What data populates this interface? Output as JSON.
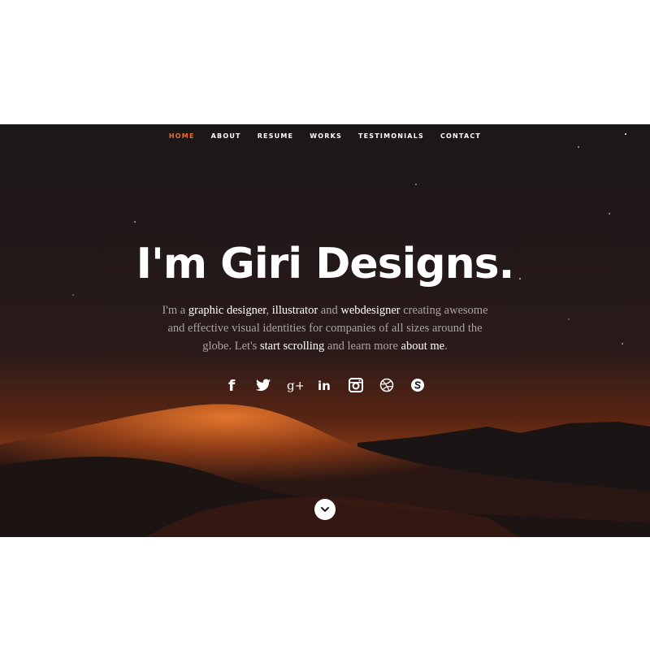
{
  "nav": {
    "items": [
      {
        "label": "HOME",
        "active": true
      },
      {
        "label": "ABOUT",
        "active": false
      },
      {
        "label": "RESUME",
        "active": false
      },
      {
        "label": "WORKS",
        "active": false
      },
      {
        "label": "TESTIMONIALS",
        "active": false
      },
      {
        "label": "CONTACT",
        "active": false
      }
    ],
    "active_color": "#f06a2a"
  },
  "hero": {
    "headline": "I'm Giri Designs.",
    "intro": {
      "p1": "I'm a ",
      "h1": "graphic designer",
      "p2": ", ",
      "h2": "illustrator",
      "p3": " and ",
      "h3": "webdesigner",
      "p4": " creating awesome and effective visual identities for companies of all sizes around the globe. Let's ",
      "h4": "start scrolling",
      "p5": " and learn more ",
      "h5": "about me",
      "p6": "."
    }
  },
  "social": [
    "facebook-icon",
    "twitter-icon",
    "google-plus-icon",
    "linkedin-icon",
    "instagram-icon",
    "dribbble-icon",
    "skype-icon"
  ],
  "social_text": {
    "linkedin": "in",
    "googleplus": "g+",
    "facebook": "f"
  },
  "scroll_icon": "chevron-down-icon"
}
